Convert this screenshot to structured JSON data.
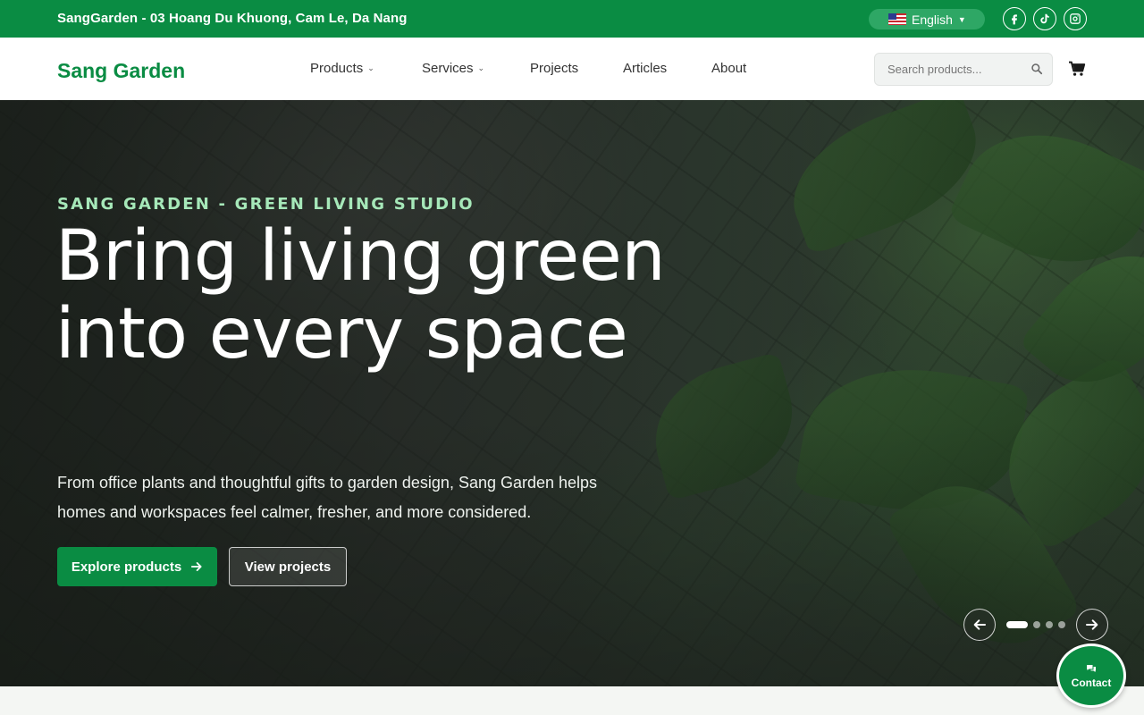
{
  "topbar": {
    "address": "SangGarden - 03 Hoang Du Khuong, Cam Le, Da Nang",
    "language": "English"
  },
  "nav": {
    "brand": "Sang Garden",
    "items": [
      {
        "label": "Products",
        "dropdown": true
      },
      {
        "label": "Services",
        "dropdown": true
      },
      {
        "label": "Projects",
        "dropdown": false
      },
      {
        "label": "Articles",
        "dropdown": false
      },
      {
        "label": "About",
        "dropdown": false
      }
    ],
    "search_placeholder": "Search products..."
  },
  "hero": {
    "kicker": "SANG GARDEN - GREEN LIVING STUDIO",
    "headline": "Bring living green into every space",
    "lead": "From office plants and thoughtful gifts to garden design, Sang Garden helps homes and workspaces feel calmer, fresher, and more considered.",
    "primary_cta": "Explore products",
    "secondary_cta": "View projects",
    "slides_total": 4,
    "active_slide": 1
  },
  "contact": {
    "label": "Contact"
  },
  "colors": {
    "brand_green": "#0a8c43",
    "kicker_green": "#a6e8b9"
  },
  "icons": [
    "flag-us-icon",
    "facebook-icon",
    "tiktok-icon",
    "instagram-icon",
    "search-icon",
    "cart-icon",
    "arrow-right-icon",
    "arrow-left-icon",
    "chat-icon"
  ]
}
